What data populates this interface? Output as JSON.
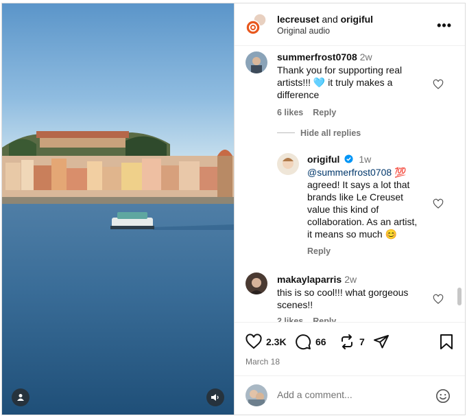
{
  "header": {
    "author_primary": "lecreuset",
    "connector": "and",
    "author_secondary": "origiful",
    "subtitle": "Original audio"
  },
  "comments": [
    {
      "username": "summerfrost0708",
      "time": "2w",
      "text_line1": "Thank you for supporting real",
      "text_line2": "artists!!! 🩵 it truly makes a",
      "text_line3": "difference",
      "likes": "6 likes",
      "reply": "Reply"
    },
    {
      "hide_replies": "Hide all replies"
    },
    {
      "username": "origiful",
      "time": "1w",
      "mention": "@summerfrost0708",
      "emoji": "💯",
      "line2": "agreed! It says a lot that",
      "line3": "brands like Le Creuset",
      "line4": "value this kind of",
      "line5": "collaboration. As an artist,",
      "line6": "it means so much 😊",
      "reply": "Reply"
    },
    {
      "username": "makaylaparris",
      "time": "2w",
      "text_line1": "this is so cool!!! what gorgeous",
      "text_line2": "scenes!!",
      "likes": "2 likes",
      "reply": "Reply"
    }
  ],
  "actions": {
    "likes_count": "2.3K",
    "comments_count": "66",
    "reposts_count": "7",
    "date": "March 18"
  },
  "add_comment": {
    "placeholder": "Add a comment..."
  },
  "icons": [
    "heart-icon",
    "comment-icon",
    "repost-icon",
    "share-icon",
    "bookmark-icon",
    "emoji-icon",
    "more-icon",
    "user-tag-icon",
    "audio-icon",
    "verified-icon"
  ],
  "colors": {
    "verified": "#0095f6",
    "link": "#00376b",
    "muted": "#737373",
    "border": "#dbdbdb"
  }
}
